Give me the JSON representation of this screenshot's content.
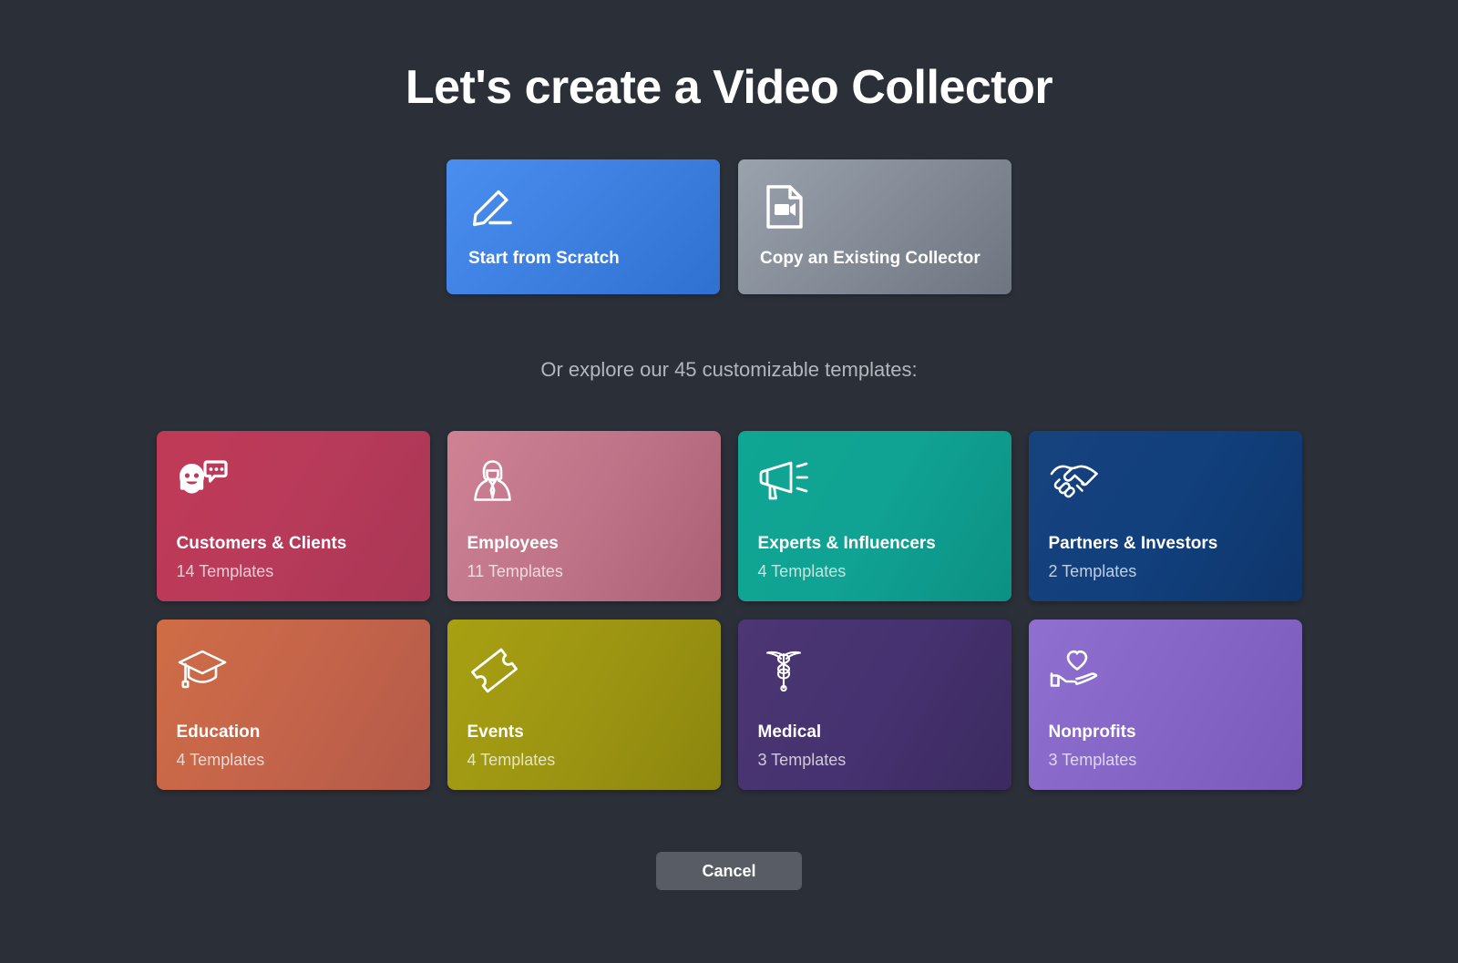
{
  "page": {
    "title": "Let's create a Video Collector",
    "background_color": "#2b2f38",
    "subhead": "Or explore our 45 customizable templates:"
  },
  "actions": [
    {
      "label": "Start from Scratch",
      "icon": "pencil-icon",
      "color": "#3b80e4",
      "name": "start-from-scratch-card"
    },
    {
      "label": "Copy an Existing Collector",
      "icon": "document-video-icon",
      "color": "#848b95",
      "name": "copy-existing-collector-card"
    }
  ],
  "categories": [
    {
      "title": "Customers & Clients",
      "count": "14 Templates",
      "icon": "face-chat-icon",
      "color": "#b93a5a"
    },
    {
      "title": "Employees",
      "count": "11 Templates",
      "icon": "employee-suit-icon",
      "color": "#bd7287"
    },
    {
      "title": "Experts & Influencers",
      "count": "4 Templates",
      "icon": "megaphone-icon",
      "color": "#10a293"
    },
    {
      "title": "Partners & Investors",
      "count": "2 Templates",
      "icon": "handshake-icon",
      "color": "#11407d"
    },
    {
      "title": "Education",
      "count": "4 Templates",
      "icon": "graduation-cap-icon",
      "color": "#c4644a"
    },
    {
      "title": "Events",
      "count": "4 Templates",
      "icon": "ticket-icon",
      "color": "#9c9512"
    },
    {
      "title": "Medical",
      "count": "3 Templates",
      "icon": "caduceus-icon",
      "color": "#463270"
    },
    {
      "title": "Nonprofits",
      "count": "3 Templates",
      "icon": "hand-heart-icon",
      "color": "#8566c6"
    }
  ],
  "footer": {
    "cancel_label": "Cancel"
  }
}
